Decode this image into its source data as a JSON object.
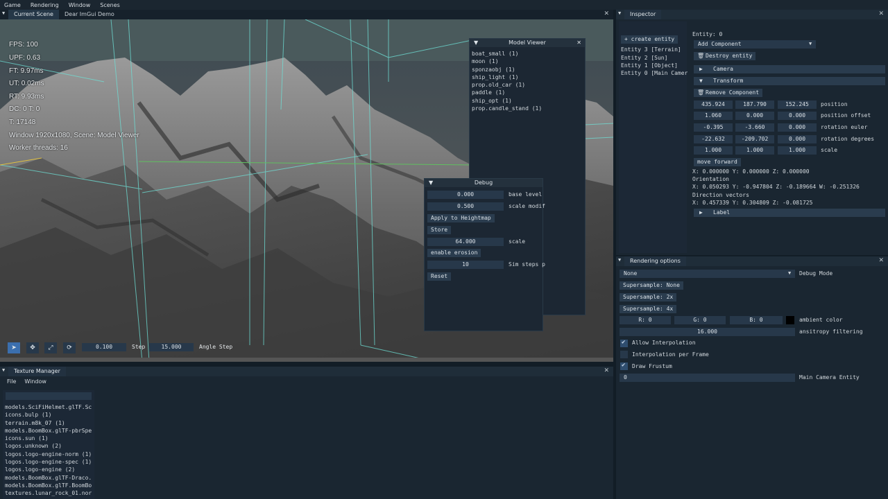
{
  "menu": [
    "Game",
    "Rendering",
    "Window",
    "Scenes"
  ],
  "scene_tabs": [
    "Current Scene",
    "Dear ImGui Demo"
  ],
  "overlay": {
    "fps": "FPS: 100",
    "upf": "UPF: 0.63",
    "ft": "FT: 9.97ms",
    "ut": "UT: 0.02ms",
    "rt": "RT: 9.93ms",
    "dc": "DC: 0 T: 0",
    "t": "T: 17148",
    "window": "Window 1920x1080, Scene: Model Viewer",
    "workers": "Worker threads: 16"
  },
  "model_viewer": {
    "title": "Model Viewer",
    "items": [
      "boat_small (1)",
      "moon (1)",
      "sponzaobj (1)",
      "ship_light (1)",
      "prop.old_car (1)",
      "paddle (1)",
      "ship_opt (1)",
      "prop.candle_stand (1)"
    ]
  },
  "debug": {
    "title": "Debug",
    "base_level_value": "0.000",
    "base_level_label": "base level",
    "scale_modifier_value": "0.500",
    "scale_modifier_label": "scale modif",
    "apply_heightmap": "Apply to Heightmap",
    "store": "Store",
    "scale_value": "64.000",
    "scale_label": "scale",
    "enable_erosion": "enable erosion",
    "sim_steps_value": "10",
    "sim_steps_label": "Sim steps p",
    "reset": "Reset"
  },
  "toolbar": {
    "step_value": "0.100",
    "step_label": "Step",
    "angle_step_value": "15.000",
    "angle_step_label": "Angle Step"
  },
  "texture_manager": {
    "title": "Texture Manager",
    "menu": [
      "File",
      "Window"
    ],
    "search_value": "",
    "items": [
      "models.SciFiHelmet.glTF.Sc",
      "icons.bulp (1)",
      "terrain.m8k_07 (1)",
      "models.BoomBox.glTF-pbrSpe",
      "icons.sun (1)",
      "logos.unknown (2)",
      "logos.logo-engine-norm (1)",
      "logos.logo-engine-spec (1)",
      "logos.logo-engine (2)",
      "models.BoomBox.glTF-Draco.",
      "models.BoomBox.glTF.BoomBo",
      "textures.lunar_rock_01.nor"
    ]
  },
  "inspector": {
    "title": "Inspector",
    "create_entity": "+ create entity",
    "entities": [
      "Entity 3 [Terrain]",
      "Entity 2 [Sun]",
      "Entity 1 [Object]",
      "Entity 0 [Main Camer"
    ],
    "entity_label": "Entity: 0",
    "add_component": "Add Component",
    "destroy_entity": "Destroy entity",
    "camera_header": "Camera",
    "transform_header": "Transform",
    "remove_component": "Remove Component",
    "position": [
      "435.924",
      "187.790",
      "152.245"
    ],
    "position_label": "position",
    "position_offset": [
      "1.060",
      "0.000",
      "0.000"
    ],
    "position_offset_label": "position offset",
    "rotation_euler": [
      "-0.395",
      "-3.660",
      "0.000"
    ],
    "rotation_euler_label": "rotation euler",
    "rotation_degrees": [
      "-22.632",
      "-209.702",
      "0.000"
    ],
    "rotation_degrees_label": "rotation degrees",
    "scale": [
      "1.000",
      "1.000",
      "1.000"
    ],
    "scale_label": "scale",
    "move_forward": "move forward",
    "xyz": "X: 0.000000 Y: 0.000000 Z: 0.000000",
    "orientation_label": "Orientation",
    "orientation": "X: 0.050293 Y: -0.947804 Z: -0.189664 W: -0.251326",
    "direction_label": "Direction vectors",
    "direction": "X: 0.457339 Y: 0.304809 Z: -0.081725",
    "label_header": "Label"
  },
  "rendering_options": {
    "title": "Rendering options",
    "debug_mode_value": "None",
    "debug_mode_label": "Debug Mode",
    "supersample_none": "Supersample: None",
    "supersample_2x": "Supersample: 2x",
    "supersample_4x": "Supersample: 4x",
    "r": "R:  0",
    "g": "G:  0",
    "b": "B:  0",
    "ambient_label": "ambient color",
    "anisotropy_value": "16.000",
    "anisotropy_label": "ansitropy filtering",
    "allow_interpolation": "Allow Interpolation",
    "allow_interpolation_checked": true,
    "interpolation_per_frame": "Interpolation per Frame",
    "interpolation_per_frame_checked": false,
    "draw_frustum": "Draw Frustum",
    "draw_frustum_checked": true,
    "main_camera_value": "0",
    "main_camera_label": "Main Camera Entity"
  },
  "colors": {
    "accent": "#3b6fae",
    "panel": "#1a2631",
    "field": "#27384a",
    "frustum": "#6ee0d6"
  }
}
